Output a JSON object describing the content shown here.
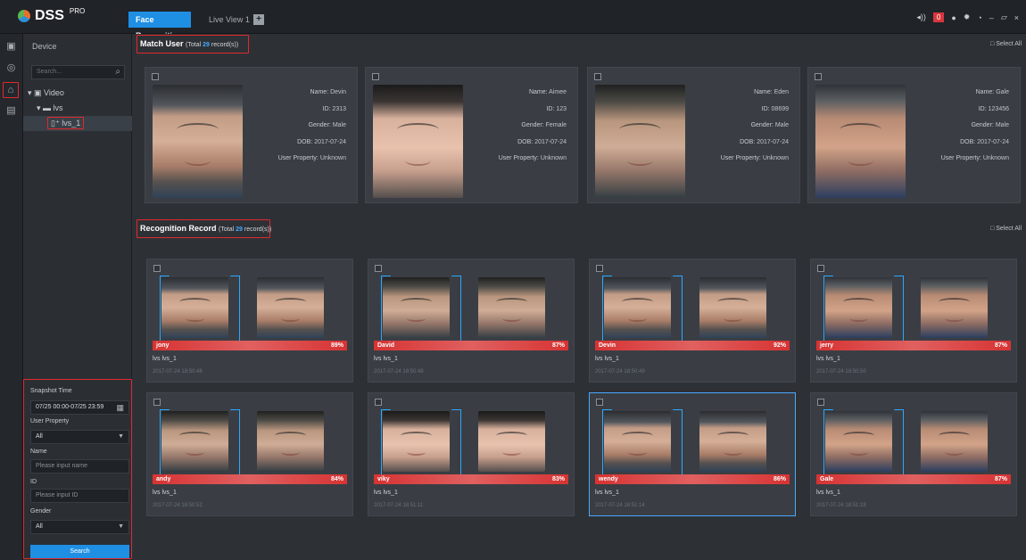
{
  "app": {
    "logo": "DSS",
    "logo_sup": "PRO",
    "tabs": [
      "Face Recognition",
      "Live View 1"
    ],
    "add_tab": "+",
    "alarm_count": "0"
  },
  "sidebar": {
    "title": "Device",
    "search_placeholder": "Search...",
    "tree": [
      "Video",
      "lvs",
      "lvs_1"
    ]
  },
  "filters": {
    "snapshot_label": "Snapshot Time",
    "snapshot_value": "07/25 00:00-07/25 23:59",
    "user_property_label": "User Property",
    "user_property_value": "All",
    "name_label": "Name",
    "name_placeholder": "Please input name",
    "id_label": "ID",
    "id_placeholder": "Please input ID",
    "gender_label": "Gender",
    "gender_value": "All",
    "search_button": "Search"
  },
  "match_user": {
    "title": "Match User",
    "total_prefix": "(Total",
    "total": "29",
    "total_suffix": "record(s))",
    "select_all": "Select All",
    "users": [
      {
        "name": "Devin",
        "id": "2313",
        "gender": "Male",
        "dob": "2017-07-24",
        "property": "Unknown"
      },
      {
        "name": "Aimee",
        "id": "123",
        "gender": "Female",
        "dob": "2017-07-24",
        "property": "Unknown"
      },
      {
        "name": "Eden",
        "id": "08699",
        "gender": "Male",
        "dob": "2017-07-24",
        "property": "Unknown"
      },
      {
        "name": "Gale",
        "id": "123456",
        "gender": "Male",
        "dob": "2017-07-24",
        "property": "Unknown"
      }
    ],
    "labels": {
      "name": "Name:",
      "id": "ID:",
      "gender": "Gender:",
      "dob": "DOB:",
      "property": "User Property:"
    }
  },
  "recognition": {
    "title": "Recognition Record",
    "total_prefix": "(Total",
    "total": "29",
    "total_suffix": "record(s))",
    "select_all": "Select All",
    "records": [
      {
        "name": "jony",
        "score": "89%",
        "device": "lvs lvs_1",
        "time": "2017-07-24 18:50:48"
      },
      {
        "name": "David",
        "score": "87%",
        "device": "lvs lvs_1",
        "time": "2017-07-24 18:50:48"
      },
      {
        "name": "Devin",
        "score": "92%",
        "device": "lvs lvs_1",
        "time": "2017-07-24 18:50:49"
      },
      {
        "name": "jerry",
        "score": "87%",
        "device": "lvs lvs_1",
        "time": "2017-07-24 18:50:50"
      },
      {
        "name": "andy",
        "score": "84%",
        "device": "lvs lvs_1",
        "time": "2017-07-24 18:50:52"
      },
      {
        "name": "viky",
        "score": "83%",
        "device": "lvs lvs_1",
        "time": "2017-07-24 18:51:11"
      },
      {
        "name": "wendy",
        "score": "86%",
        "device": "lvs lvs_1",
        "time": "2017-07-24 18:51:14"
      },
      {
        "name": "Gale",
        "score": "87%",
        "device": "lvs lvs_1",
        "time": "2017-07-24 18:51:18"
      }
    ]
  }
}
